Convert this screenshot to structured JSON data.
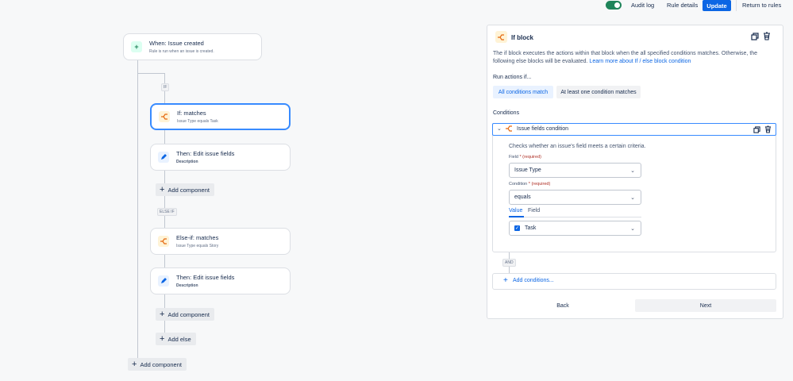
{
  "topbar": {
    "toggle_on": true,
    "audit_log": "Audit log",
    "rule_details": "Rule details",
    "update": "Update",
    "return_to_rules": "Return to rules"
  },
  "flow": {
    "trigger": {
      "title": "When: Issue created",
      "subtitle": "Rule is run when an issue is created.",
      "icon": "plus-icon"
    },
    "if_label": "IF",
    "if_block": {
      "title": "If: matches",
      "subtitle": "Issue Type equals Task",
      "icon": "branch-icon"
    },
    "then_1": {
      "title": "Then: Edit issue fields",
      "subtitle": "Description",
      "icon": "pencil-icon"
    },
    "add_component_inner_1": "Add component",
    "else_if_label": "ELSE IF",
    "else_if_block": {
      "title": "Else-if: matches",
      "subtitle": "Issue Type equals Story",
      "icon": "branch-icon"
    },
    "then_2": {
      "title": "Then: Edit issue fields",
      "subtitle": "Description",
      "icon": "pencil-icon"
    },
    "add_component_inner_2": "Add component",
    "add_else": "Add else",
    "add_component_outer": "Add component"
  },
  "panel": {
    "title": "If block",
    "description": "The if block executes the actions within that block when the all specified conditions matches. Otherwise, the following else blocks will be evaluated.",
    "learn_more": "Learn more about If / else block condition",
    "run_actions_label": "Run actions if...",
    "options": [
      "All conditions match",
      "At least one condition matches"
    ],
    "selected_option": "All conditions match",
    "conditions_label": "Conditions",
    "condition": {
      "title": "Issue fields condition",
      "description": "Checks whether an issue's field meets a certain criteria.",
      "field_label": "Field",
      "field_required": "(required)",
      "field_value": "Issue Type",
      "condition_label": "Condition",
      "condition_required": "(required)",
      "condition_value": "equals",
      "tabs": [
        "Value",
        "Field"
      ],
      "active_tab": "Value",
      "value": "Task",
      "value_checked": true
    },
    "and_label": "AND",
    "add_conditions": "Add conditions...",
    "back": "Back",
    "next": "Next"
  },
  "colors": {
    "accent": "#0c66e4",
    "selected_border": "#388bff",
    "toggle": "#1f845a",
    "required": "#ae2e24"
  }
}
